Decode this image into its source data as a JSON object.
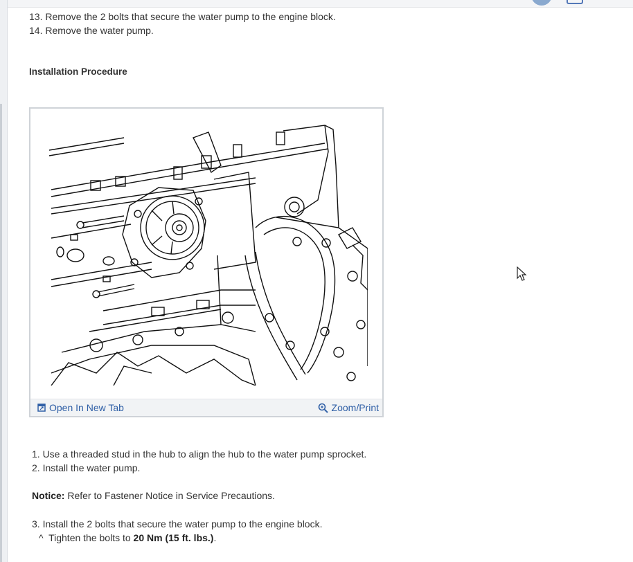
{
  "removal_steps": [
    "13. Remove the 2 bolts that secure the water pump to the engine block.",
    "14. Remove the water pump."
  ],
  "installation_heading": "Installation Procedure",
  "figure": {
    "open_tab_label": "Open In New Tab",
    "zoom_label": "Zoom/Print"
  },
  "install_steps": {
    "step1": "1. Use a threaded stud in the hub to align the hub to the water pump sprocket.",
    "step2": "2. Install the water pump.",
    "notice_label": "Notice:",
    "notice_text": " Refer to Fastener Notice in Service Precautions.",
    "step3": "3. Install the 2 bolts that secure the water pump to the engine block.",
    "sub_prefix": "^  Tighten the bolts to ",
    "torque": "20 Nm (15 ft. lbs.)",
    "sub_suffix": "."
  },
  "colors": {
    "link": "#2f5fa6",
    "text": "#333333"
  },
  "icons": [
    "open-new-tab-icon",
    "zoom-icon",
    "mouse-cursor-icon"
  ]
}
